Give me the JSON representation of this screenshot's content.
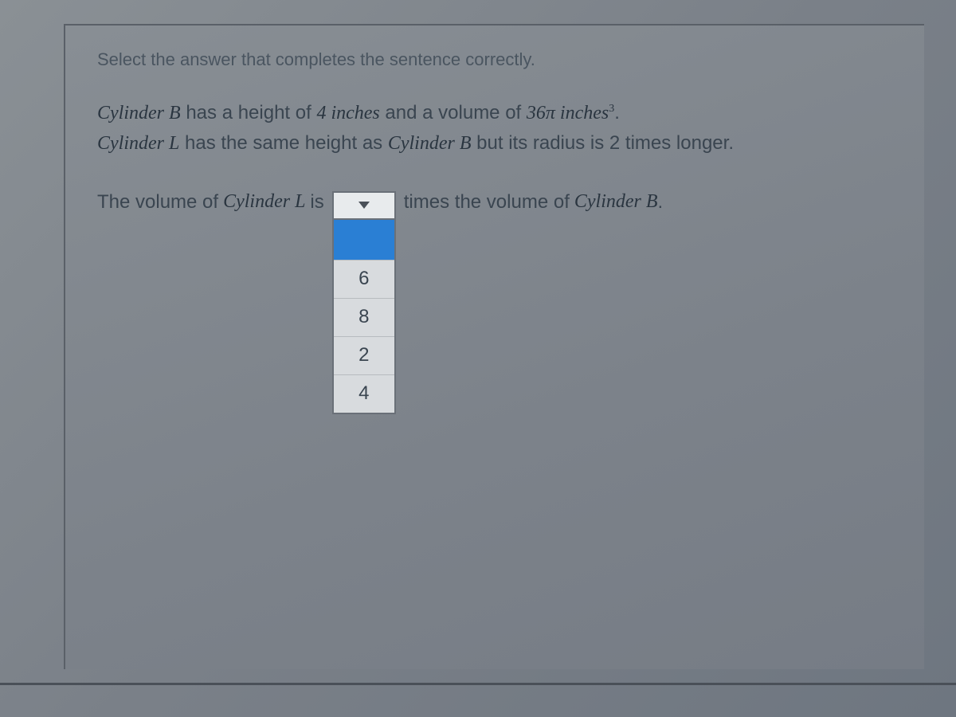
{
  "instruction": "Select the answer that completes the sentence correctly.",
  "problem": {
    "line1_prefix": "",
    "cylinder_b": "Cylinder B",
    "line1_mid1": " has a height of ",
    "height_val": "4 inches",
    "line1_mid2": " and a volume of ",
    "volume_val": "36π inches",
    "volume_exp": "3",
    "line1_end": ".",
    "cylinder_l": "Cylinder L",
    "line2_mid1": " has the same height as ",
    "line2_end": " but its radius is 2 times longer."
  },
  "question": {
    "prefix": "The volume of ",
    "term1": "Cylinder L",
    "mid": " is",
    "suffix_pre": "times the volume of ",
    "term2": "Cylinder B",
    "suffix_end": "."
  },
  "dropdown": {
    "selected": "",
    "options": [
      "",
      "6",
      "8",
      "2",
      "4"
    ]
  }
}
